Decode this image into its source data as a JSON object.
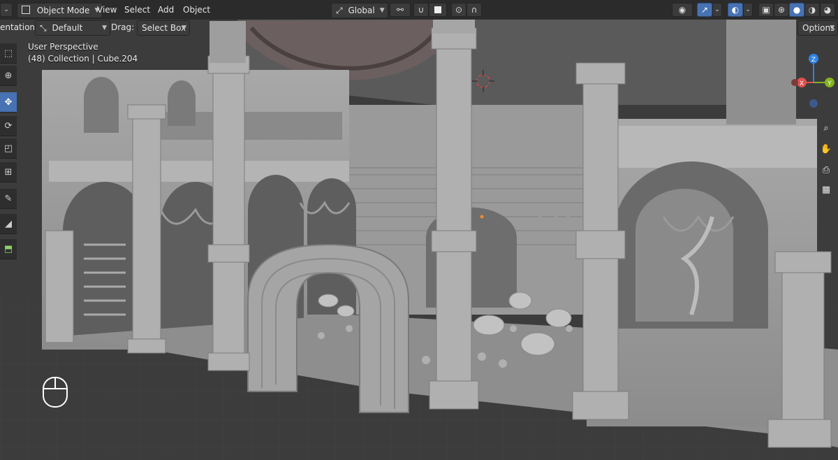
{
  "header": {
    "mode_label": "Object Mode",
    "menus": [
      "View",
      "Select",
      "Add",
      "Object"
    ],
    "transform_orientation_value": "Global"
  },
  "tool_settings": {
    "orientation_label": "entation:",
    "orientation_value": "Default",
    "drag_label": "Drag:",
    "drag_value": "Select Box",
    "options_label": "Options"
  },
  "viewport": {
    "perspective_label": "User Perspective",
    "collection_label": "(48) Collection | Cube.204"
  },
  "nav_gizmo": {
    "axis_z": "Z",
    "axis_x": "X",
    "axis_y": "Y"
  },
  "colors": {
    "accent": "#4772b3",
    "axis_x": "#e0504f",
    "axis_y": "#83b31f",
    "axis_z": "#2f83e3"
  }
}
